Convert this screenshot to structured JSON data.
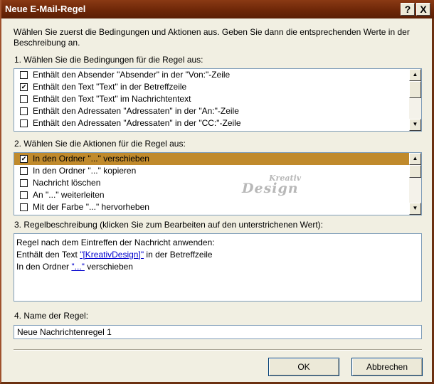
{
  "window": {
    "title": "Neue E-Mail-Regel",
    "help_label": "?",
    "close_label": "X"
  },
  "intro": "Wählen Sie zuerst die Bedingungen und Aktionen aus. Geben Sie dann die entsprechenden Werte in der Beschreibung an.",
  "conditions": {
    "label": "1. Wählen Sie die Bedingungen für die Regel aus:",
    "items": [
      {
        "label": "Enthält den Absender \"Absender\" in der \"Von:\"-Zeile",
        "checked": false
      },
      {
        "label": "Enthält den Text \"Text\" in der Betreffzeile",
        "checked": true
      },
      {
        "label": "Enthält den Text \"Text\" im Nachrichtentext",
        "checked": false
      },
      {
        "label": "Enthält den Adressaten \"Adressaten\" in der \"An:\"-Zeile",
        "checked": false
      },
      {
        "label": "Enthält den Adressaten \"Adressaten\" in der \"CC:\"-Zeile",
        "checked": false
      }
    ]
  },
  "actions": {
    "label": "2. Wählen Sie die Aktionen für die Regel aus:",
    "items": [
      {
        "label": "In den Ordner \"...\" verschieben",
        "checked": true,
        "selected": true
      },
      {
        "label": "In den Ordner \"...\" kopieren",
        "checked": false
      },
      {
        "label": "Nachricht löschen",
        "checked": false
      },
      {
        "label": "An \"...\" weiterleiten",
        "checked": false
      },
      {
        "label": "Mit der Farbe \"...\" hervorheben",
        "checked": false
      }
    ]
  },
  "description": {
    "label": "3. Regelbeschreibung (klicken Sie zum Bearbeiten auf den unterstrichenen Wert):",
    "line1": "Regel nach dem Eintreffen der Nachricht anwenden:",
    "line2_prefix": "Enthält den Text ",
    "line2_link": "\"[KreativDesign]\"",
    "line2_suffix": " in der Betreffzeile",
    "line3_prefix": "In den Ordner ",
    "line3_link": "\"...\"",
    "line3_suffix": " verschieben"
  },
  "name": {
    "label": "4. Name der Regel:",
    "value": "Neue Nachrichtenregel 1"
  },
  "buttons": {
    "ok": "OK",
    "cancel": "Abbrechen"
  },
  "watermark": {
    "line1": "Kreativ",
    "line2": "Design"
  }
}
